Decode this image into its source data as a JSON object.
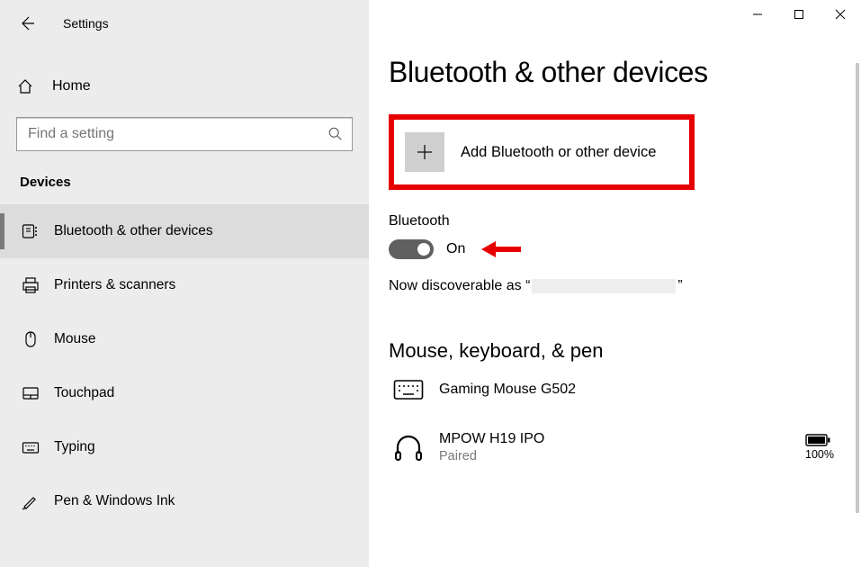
{
  "window": {
    "title": "Settings"
  },
  "sidebar": {
    "home": "Home",
    "search_placeholder": "Find a setting",
    "category": "Devices",
    "items": [
      {
        "label": "Bluetooth & other devices"
      },
      {
        "label": "Printers & scanners"
      },
      {
        "label": "Mouse"
      },
      {
        "label": "Touchpad"
      },
      {
        "label": "Typing"
      },
      {
        "label": "Pen & Windows Ink"
      }
    ]
  },
  "main": {
    "page_title": "Bluetooth & other devices",
    "add_device_label": "Add Bluetooth or other device",
    "bt_section": "Bluetooth",
    "toggle_state": "On",
    "discover_prefix": "Now discoverable as “",
    "discover_suffix": "”",
    "section_mkp": "Mouse, keyboard, & pen",
    "devices": [
      {
        "name": "Gaming Mouse G502",
        "status": "",
        "battery": ""
      },
      {
        "name": "MPOW H19 IPO",
        "status": "Paired",
        "battery": "100%"
      }
    ]
  }
}
